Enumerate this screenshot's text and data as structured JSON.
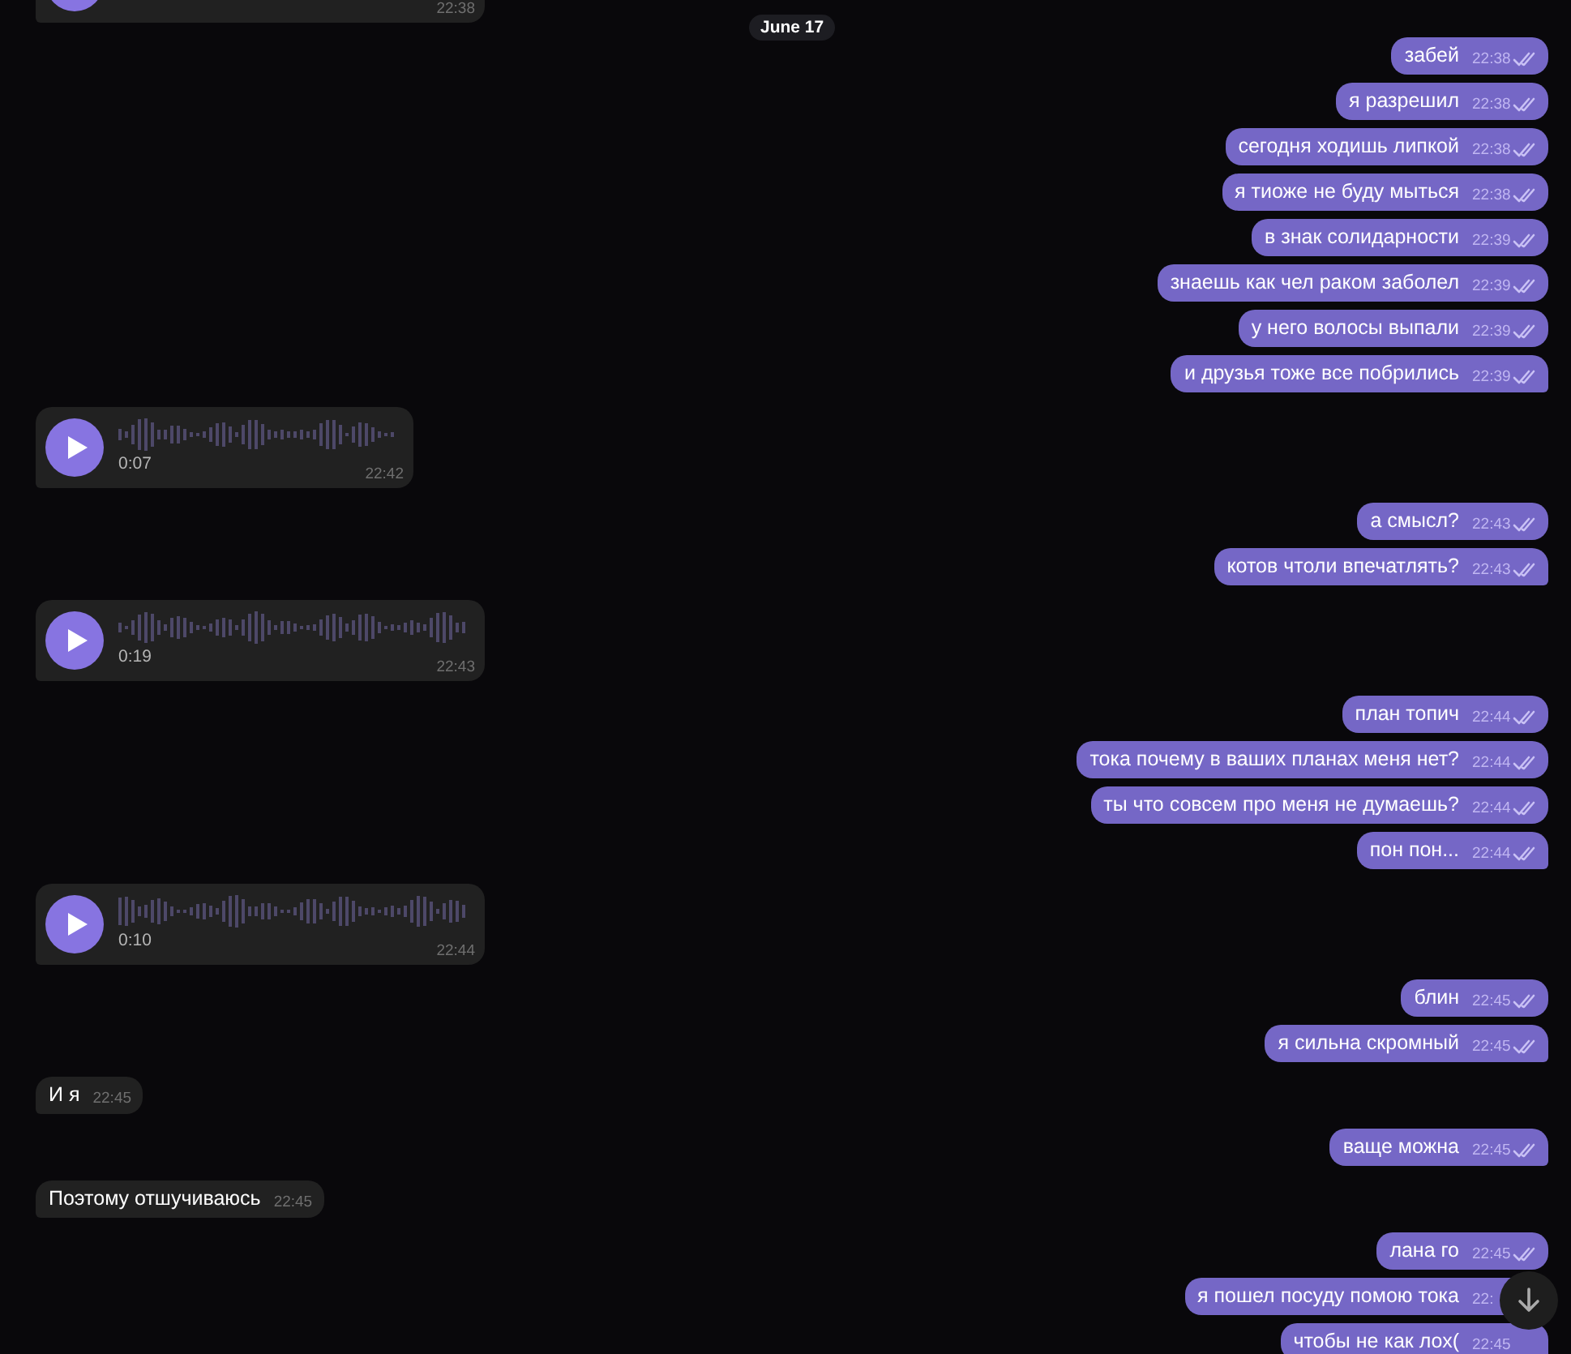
{
  "date_pill": "June 17",
  "messages": [
    {
      "kind": "voice",
      "outgoing": false,
      "time": "22:38"
    },
    {
      "kind": "text",
      "outgoing": true,
      "text": "забей",
      "time": "22:38",
      "read": true
    },
    {
      "kind": "text",
      "outgoing": true,
      "text": "я разрешил",
      "time": "22:38",
      "read": true
    },
    {
      "kind": "text",
      "outgoing": true,
      "text": "сегодня ходишь липкой",
      "time": "22:38",
      "read": true
    },
    {
      "kind": "text",
      "outgoing": true,
      "text": "я тиоже не буду мыться",
      "time": "22:38",
      "read": true
    },
    {
      "kind": "text",
      "outgoing": true,
      "text": "в знак солидарности",
      "time": "22:39",
      "read": true
    },
    {
      "kind": "text",
      "outgoing": true,
      "text": "знаешь как чел раком заболел",
      "time": "22:39",
      "read": true
    },
    {
      "kind": "text",
      "outgoing": true,
      "text": "у него волосы выпали",
      "time": "22:39",
      "read": true
    },
    {
      "kind": "text",
      "outgoing": true,
      "text": "и друзья тоже все побрились",
      "time": "22:39",
      "read": true
    },
    {
      "kind": "voice",
      "outgoing": false,
      "duration": "0:07",
      "time": "22:42"
    },
    {
      "kind": "text",
      "outgoing": true,
      "text": "а смысл?",
      "time": "22:43",
      "read": true
    },
    {
      "kind": "text",
      "outgoing": true,
      "text": "котов чтоли впечатлять?",
      "time": "22:43",
      "read": true
    },
    {
      "kind": "voice",
      "outgoing": false,
      "duration": "0:19",
      "time": "22:43"
    },
    {
      "kind": "text",
      "outgoing": true,
      "text": "план топич",
      "time": "22:44",
      "read": true
    },
    {
      "kind": "text",
      "outgoing": true,
      "text": "тока почему в ваших планах меня нет?",
      "time": "22:44",
      "read": true
    },
    {
      "kind": "text",
      "outgoing": true,
      "text": "ты что совсем про меня не думаешь?",
      "time": "22:44",
      "read": true
    },
    {
      "kind": "text",
      "outgoing": true,
      "text": "пон пон...",
      "time": "22:44",
      "read": true
    },
    {
      "kind": "voice",
      "outgoing": false,
      "duration": "0:10",
      "time": "22:44"
    },
    {
      "kind": "text",
      "outgoing": true,
      "text": "блин",
      "time": "22:45",
      "read": true
    },
    {
      "kind": "text",
      "outgoing": true,
      "text": "я сильна скромный",
      "time": "22:45",
      "read": true
    },
    {
      "kind": "text",
      "outgoing": false,
      "text": "И я",
      "time": "22:45"
    },
    {
      "kind": "text",
      "outgoing": true,
      "text": "ваще можна",
      "time": "22:45",
      "read": true
    },
    {
      "kind": "text",
      "outgoing": false,
      "text": "Поэтому отшучиваюсь",
      "time": "22:45"
    },
    {
      "kind": "text",
      "outgoing": true,
      "text": "лана го",
      "time": "22:45",
      "read": true
    },
    {
      "kind": "text",
      "outgoing": true,
      "text": "я пошел посуду помою тока",
      "time": "22:"
    },
    {
      "kind": "text",
      "outgoing": true,
      "text": "чтобы не как лох(",
      "time": "22:45"
    }
  ]
}
